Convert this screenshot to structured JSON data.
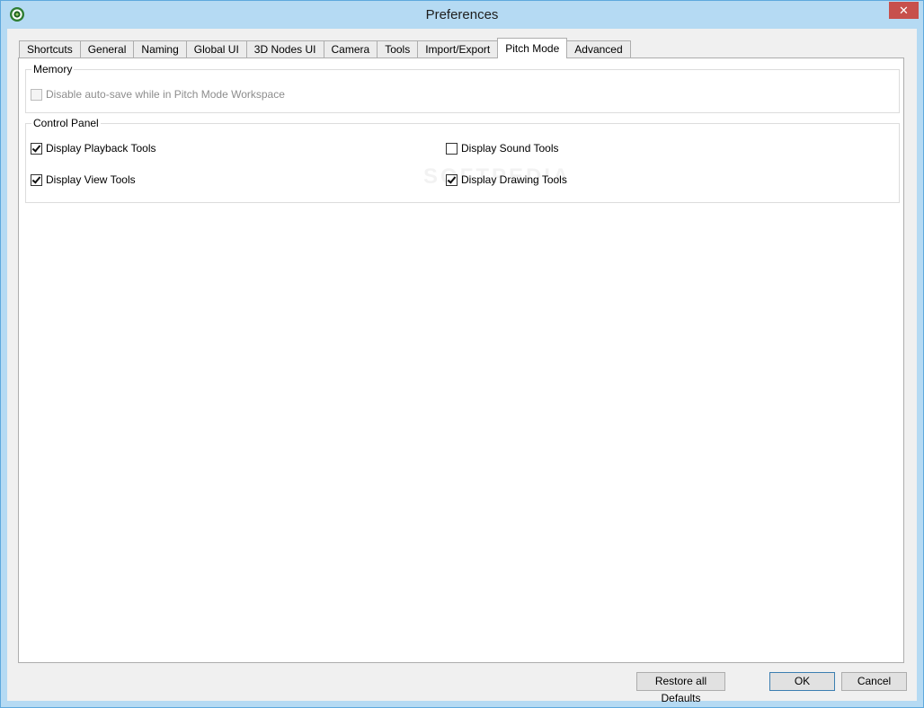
{
  "window": {
    "title": "Preferences",
    "close_glyph": "✕"
  },
  "tabs": [
    {
      "label": "Shortcuts"
    },
    {
      "label": "General"
    },
    {
      "label": "Naming"
    },
    {
      "label": "Global UI"
    },
    {
      "label": "3D Nodes UI"
    },
    {
      "label": "Camera"
    },
    {
      "label": "Tools"
    },
    {
      "label": "Import/Export"
    },
    {
      "label": "Pitch Mode",
      "active": true
    },
    {
      "label": "Advanced"
    }
  ],
  "memory": {
    "legend": "Memory",
    "disable_autosave": {
      "label": "Disable auto-save while in Pitch Mode Workspace",
      "checked": false,
      "disabled": true
    }
  },
  "control_panel": {
    "legend": "Control Panel",
    "display_playback_tools": {
      "label": "Display Playback Tools",
      "checked": true
    },
    "display_view_tools": {
      "label": "Display View Tools",
      "checked": true
    },
    "display_sound_tools": {
      "label": "Display Sound Tools",
      "checked": false
    },
    "display_drawing_tools": {
      "label": "Display Drawing Tools",
      "checked": true
    }
  },
  "footer": {
    "restore_label": "Restore all Defaults",
    "ok_label": "OK",
    "cancel_label": "Cancel"
  },
  "watermark": "SOFTPEDIA",
  "colors": {
    "frame": "#b5daf3",
    "close_button": "#c7504c",
    "default_button_border": "#3c7fb1"
  },
  "icons": {
    "app": "app-logo-icon",
    "close": "close-icon",
    "check": "checkmark-icon"
  }
}
